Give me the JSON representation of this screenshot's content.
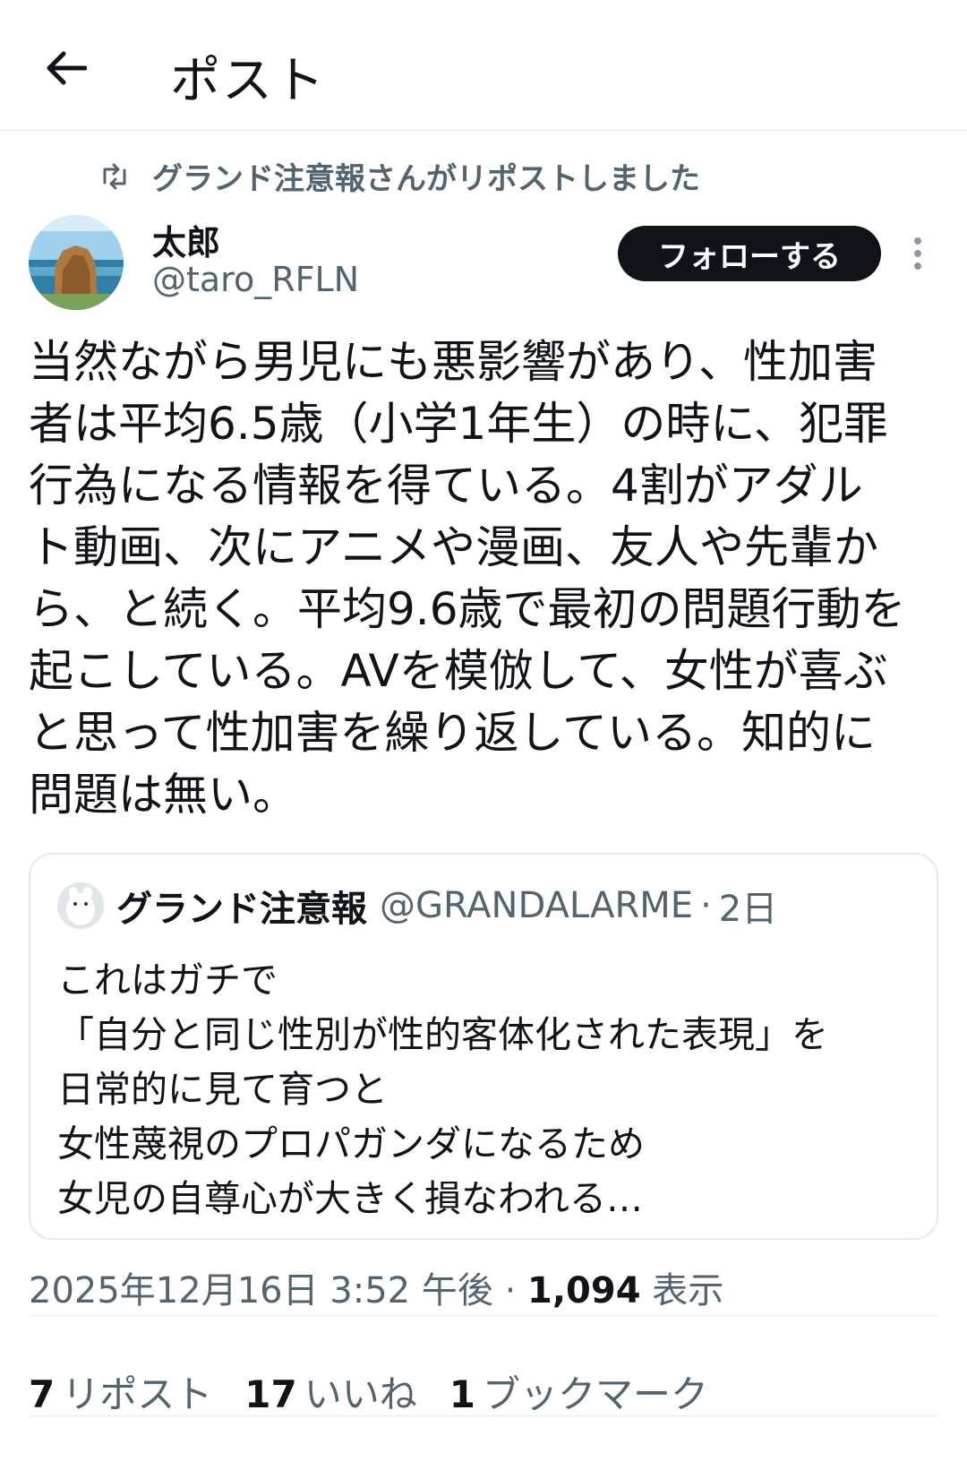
{
  "header": {
    "title": "ポスト"
  },
  "repost": {
    "text": "グランド注意報さんがリポストしました"
  },
  "author": {
    "name": "太郎",
    "handle": "@taro_RFLN",
    "follow_label": "フォローする"
  },
  "tweet": {
    "text": "当然ながら男児にも悪影響があり、性加害\n者は平均6.5歳（小学1年生）の時に、犯罪\n行為になる情報を得ている。4割がアダル\nト動画、次にアニメや漫画、友人や先輩か\nら、と続く。平均9.6歳で最初の問題行動を\n起こしている。AVを模倣して、女性が喜ぶ\nと思って性加害を繰り返している。知的に\n問題は無い。"
  },
  "quote": {
    "name": "グランド注意報",
    "handle": "@GRANDALARME",
    "dot": "·",
    "time": "2日",
    "text": "これはガチで\n「自分と同じ性別が性的客体化された表現」を\n日常的に見て育つと\n女性蔑視のプロパガンダになるため\n女児の自尊心が大きく損なわれる…"
  },
  "meta": {
    "timestamp": "2025年12月16日 3:52 午後",
    "dot": "·",
    "views_count": "1,094",
    "views_label": "表示"
  },
  "stats": {
    "reposts_count": "7",
    "reposts_label": "リポスト",
    "likes_count": "17",
    "likes_label": "いいね",
    "bookmarks_count": "1",
    "bookmarks_label": "ブックマーク"
  },
  "icons": {
    "back": "arrow-left-icon",
    "repost": "repost-icon",
    "more": "more-vertical-icon"
  },
  "colors": {
    "text": "#0f1419",
    "secondary": "#536471",
    "border": "#e6e9ec",
    "follow_bg": "#0f1419"
  }
}
